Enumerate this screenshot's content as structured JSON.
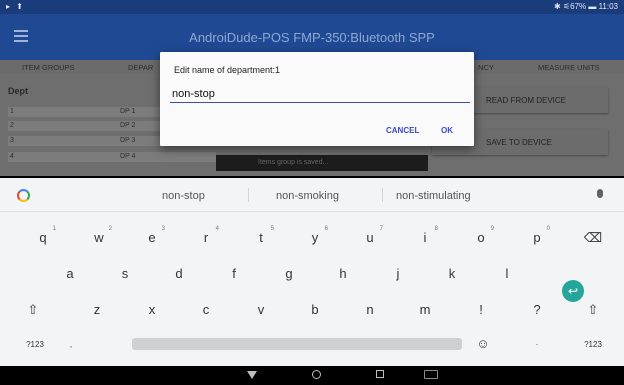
{
  "status_bar": {
    "left_icons": "▸ ⬆",
    "right_text": "✱ ⚟67% ▬ 11:03"
  },
  "app": {
    "title": "AndroiDude-POS   FMP-350:Bluetooth SPP"
  },
  "tabs": [
    "ITEM GROUPS",
    "DEPAR",
    "NCY",
    "MEASURE UNITS"
  ],
  "departments": {
    "title": "Dept",
    "rows": [
      {
        "num": "1",
        "name": "DP 1"
      },
      {
        "num": "2",
        "name": "DP 2"
      },
      {
        "num": "3",
        "name": "DP 3"
      },
      {
        "num": "4",
        "name": "DP 4"
      }
    ]
  },
  "buttons": {
    "read": "READ FROM DEVICE",
    "save": "SAVE TO DEVICE"
  },
  "toast": {
    "text": "Items group is saved..."
  },
  "dialog": {
    "title": "Edit name of department:1",
    "input_value": "non-stop",
    "cancel": "CANCEL",
    "ok": "OK"
  },
  "keyboard": {
    "suggestions": [
      "non-stop",
      "non-smoking",
      "non-stimulating"
    ],
    "row1": [
      {
        "k": "q",
        "h": "1"
      },
      {
        "k": "w",
        "h": "2"
      },
      {
        "k": "e",
        "h": "3"
      },
      {
        "k": "r",
        "h": "4"
      },
      {
        "k": "t",
        "h": "5"
      },
      {
        "k": "y",
        "h": "6"
      },
      {
        "k": "u",
        "h": "7"
      },
      {
        "k": "i",
        "h": "8"
      },
      {
        "k": "o",
        "h": "9"
      },
      {
        "k": "p",
        "h": "0"
      },
      {
        "k": "⌫",
        "h": ""
      }
    ],
    "row2": [
      "a",
      "s",
      "d",
      "f",
      "g",
      "h",
      "j",
      "k",
      "l"
    ],
    "row3": [
      "⇧",
      "z",
      "x",
      "c",
      "v",
      "b",
      "n",
      "m",
      "!",
      "?",
      "⇧"
    ],
    "row4": {
      "sym": "?123",
      "comma": ",",
      "emoji": "☺",
      "period": "·",
      "sym_right": "?123"
    },
    "enter": "↩"
  },
  "colors": {
    "app_bar": "#1f4a93",
    "accent": "#3a49c9",
    "enter": "#26a69a"
  }
}
